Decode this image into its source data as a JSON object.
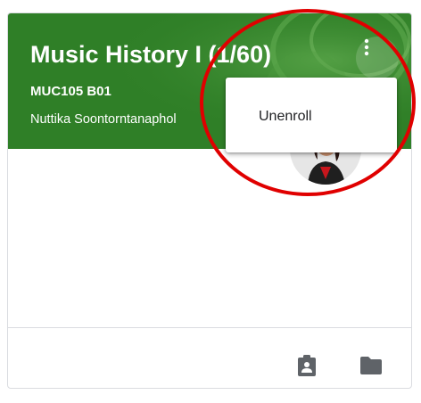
{
  "course": {
    "title": "Music History I (1/60)",
    "section": "MUC105 B01",
    "teacher": "Nuttika Soontorntanaphol"
  },
  "overflow_menu": {
    "button_icon": "more-vert-icon",
    "items": [
      {
        "label": "Unenroll"
      }
    ]
  },
  "footer": {
    "icons": [
      "assignment-icon",
      "folder-icon"
    ]
  },
  "colors": {
    "banner": "#2f7f27",
    "annotation": "#e00000",
    "icon": "#5f6368"
  }
}
